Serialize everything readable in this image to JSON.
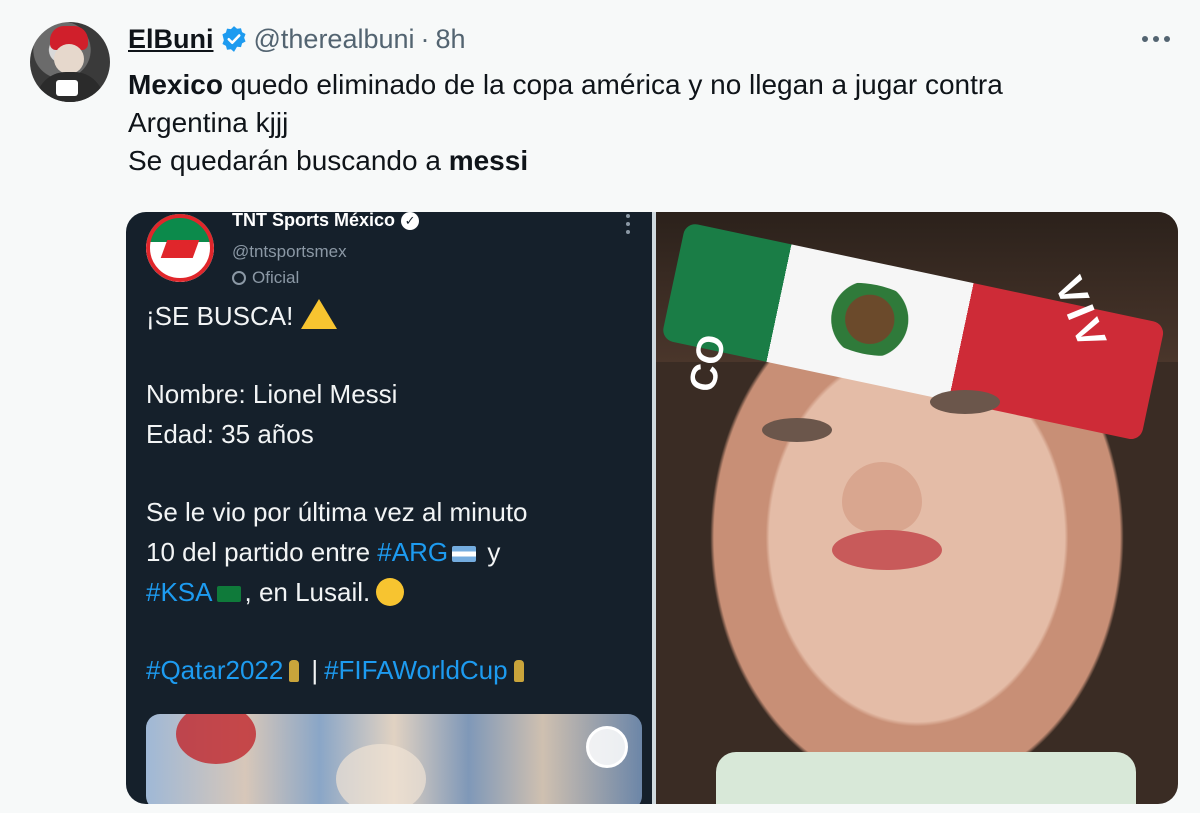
{
  "tweet": {
    "author_name": "ElBuni",
    "handle": "@therealbuni",
    "separator": "·",
    "time": "8h",
    "text_line1_bold": "Mexico",
    "text_line1_rest": " quedo eliminado de la copa américa y no llegan a jugar contra",
    "text_line2": "Argentina kjjj",
    "text_line3_prefix": "Se quedarán buscando a ",
    "text_line3_bold": "messi"
  },
  "embedded_post": {
    "account_name": "TNT Sports México",
    "account_handle": "@tntsportsmex",
    "account_label": "Oficial",
    "title": "¡SE BUSCA!",
    "name_line": "Nombre: Lionel Messi",
    "age_line": "Edad: 35 años",
    "seen_line1": "Se le vio por última vez al minuto",
    "seen_line2_prefix": "10 del partido entre ",
    "hashtag_arg": "#ARG",
    "seen_line2_suffix": " y",
    "hashtag_ksa": "#KSA",
    "seen_line3_suffix": ", en Lusail.",
    "hashtag_qatar": "#Qatar2022",
    "hashtag_separator": "|",
    "hashtag_fifa": "#FIFAWorldCup"
  },
  "photo": {
    "headband_text_right": "VIV",
    "headband_text_left": "CO"
  },
  "icons": [
    "verified-badge-icon",
    "more-options-icon",
    "warning-icon",
    "argentina-flag-icon",
    "saudi-flag-icon",
    "anxious-face-icon",
    "trophy-icon"
  ],
  "colors": {
    "link": "#1d9bf0",
    "verified": "#1d9bf0",
    "embed_bg": "#15202b"
  }
}
